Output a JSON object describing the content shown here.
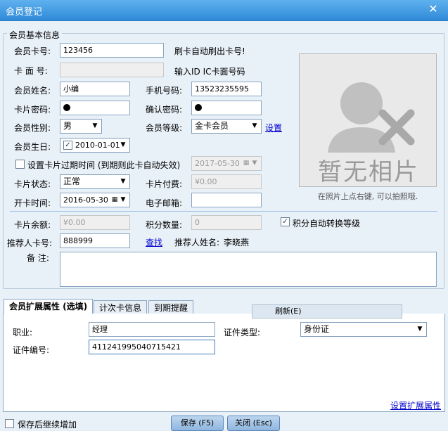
{
  "window": {
    "title": "会员登记",
    "close_glyph": "✕"
  },
  "basic": {
    "legend": "会员基本信息",
    "card_no": {
      "label": "会员卡号:",
      "value": "123456",
      "hint": "刷卡自动刷出卡号!"
    },
    "card_face": {
      "label": "卡 面 号:",
      "value": "",
      "hint": "输入ID IC卡面号码"
    },
    "name": {
      "label": "会员姓名:",
      "value": "小编"
    },
    "phone": {
      "label": "手机号码:",
      "value": "13523235595"
    },
    "password": {
      "label": "卡片密码:"
    },
    "confirm_password": {
      "label": "确认密码:"
    },
    "gender": {
      "label": "会员性别:",
      "value": "男"
    },
    "level": {
      "label": "会员等级:",
      "value": "金卡会员",
      "link": "设置"
    },
    "birthday": {
      "label": "会员生日:",
      "value": "2010-01-01",
      "checked": true
    },
    "expire": {
      "label": "设置卡片过期时间 (到期则此卡自动失效)",
      "date": "2017-05-30",
      "checked": false
    },
    "status": {
      "label": "卡片状态:",
      "value": "正常"
    },
    "fee": {
      "label": "卡片付费:",
      "value": "¥0.00"
    },
    "open_time": {
      "label": "开卡时间:",
      "value": "2016-05-30"
    },
    "email": {
      "label": "电子邮箱:",
      "value": ""
    },
    "balance": {
      "label": "卡片余额:",
      "value": "¥0.00"
    },
    "points": {
      "label": "积分数量:",
      "value": "0"
    },
    "auto_upgrade": {
      "label": "积分自动转换等级",
      "checked": true
    },
    "referrer_card": {
      "label": "推荐人卡号:",
      "value": "888999",
      "link": "查找"
    },
    "referrer_name": {
      "label": "推荐人姓名:",
      "value": "李晓燕"
    },
    "remark": {
      "label": "备  注:",
      "value": ""
    }
  },
  "photo": {
    "placeholder_text": "暂无相片",
    "caption": "在照片上点右键, 可以拍照哦."
  },
  "tabs": [
    {
      "label": "会员扩展属性 (选填)",
      "active": true
    },
    {
      "label": "计次卡信息",
      "active": false
    },
    {
      "label": "到期提醒",
      "active": false
    }
  ],
  "refresh": {
    "label": "刷新(E)"
  },
  "ext": {
    "occupation": {
      "label": "职业:",
      "value": "经理"
    },
    "id_type": {
      "label": "证件类型:",
      "value": "身份证"
    },
    "id_no": {
      "label": "证件编号:",
      "value": "411241995040715421"
    },
    "settings_link": "设置扩展属性"
  },
  "bottom": {
    "continue": {
      "label": "保存后继续增加",
      "checked": false
    },
    "save": "保存 (F5)",
    "close": "关闭 (Esc)"
  },
  "colors": {
    "title_bar": "#2f8ad8",
    "link": "#0000cc",
    "accent": "#9cc0e6"
  }
}
